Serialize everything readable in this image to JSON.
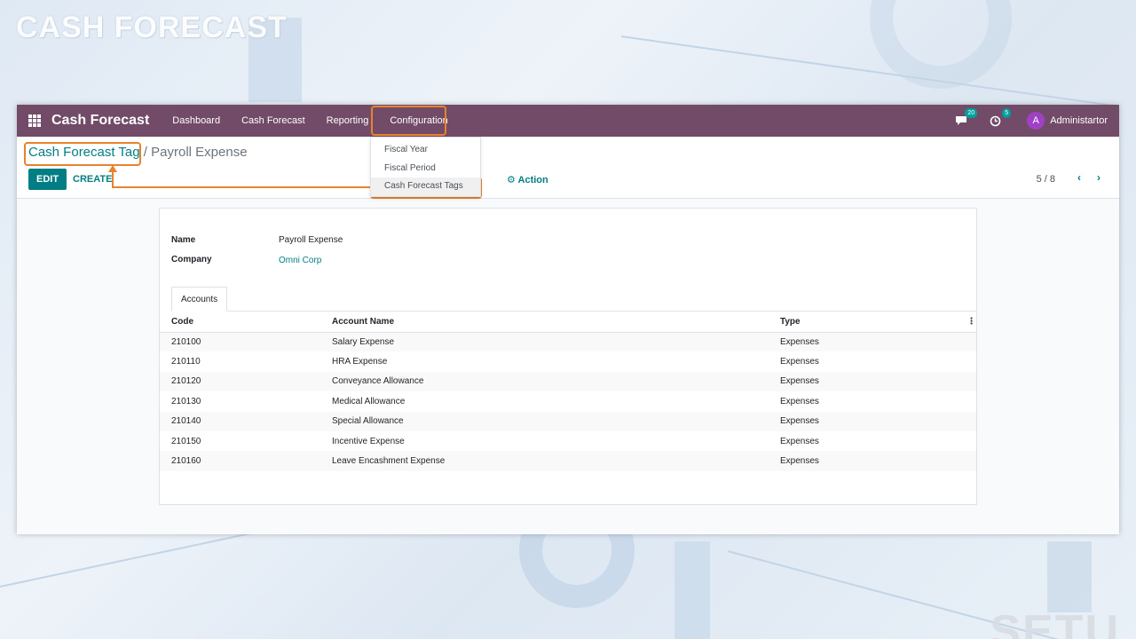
{
  "watermark": {
    "top_left": "CASH FORECAST",
    "bottom_right": "SETU"
  },
  "navbar": {
    "brand": "Cash Forecast",
    "menu": [
      "Dashboard",
      "Cash Forecast",
      "Reporting",
      "Configuration"
    ],
    "messages_count": "20",
    "activities_count": "5",
    "avatar_initial": "A",
    "user_name": "Administartor"
  },
  "dropdown": {
    "items": [
      "Fiscal Year",
      "Fiscal Period",
      "Cash Forecast Tags"
    ]
  },
  "breadcrumb": {
    "parent": "Cash Forecast Tag",
    "separator": "/",
    "current": "Payroll Expense"
  },
  "buttons": {
    "edit": "EDIT",
    "create": "CREATE",
    "action": "Action"
  },
  "pager": {
    "value": "5 / 8"
  },
  "form": {
    "name_label": "Name",
    "name_value": "Payroll Expense",
    "company_label": "Company",
    "company_value": "Omni Corp",
    "tab_label": "Accounts"
  },
  "table": {
    "headers": [
      "Code",
      "Account Name",
      "Type"
    ],
    "rows": [
      [
        "210100",
        "Salary Expense",
        "Expenses"
      ],
      [
        "210110",
        "HRA Expense",
        "Expenses"
      ],
      [
        "210120",
        "Conveyance Allowance",
        "Expenses"
      ],
      [
        "210130",
        "Medical Allowance",
        "Expenses"
      ],
      [
        "210140",
        "Special Allowance",
        "Expenses"
      ],
      [
        "210150",
        "Incentive Expense",
        "Expenses"
      ],
      [
        "210160",
        "Leave Encashment Expense",
        "Expenses"
      ]
    ]
  },
  "colors": {
    "navbar": "#714b67",
    "primary": "#017e84",
    "highlight": "#e8822b"
  }
}
